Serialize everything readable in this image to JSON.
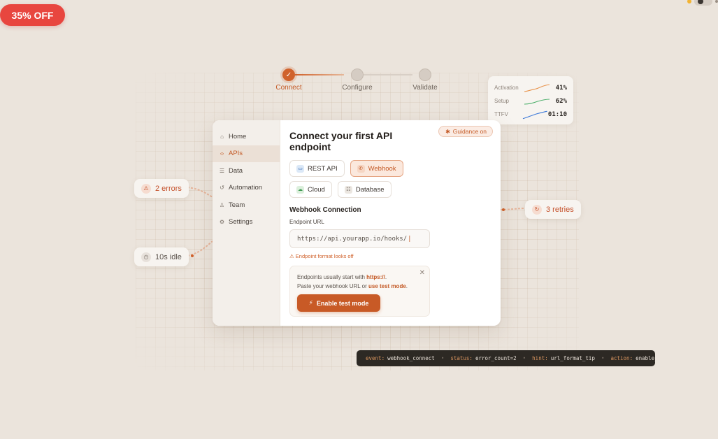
{
  "promo": {
    "label": "35% OFF"
  },
  "stepper": {
    "steps": [
      {
        "label": "Connect",
        "state": "done"
      },
      {
        "label": "Configure",
        "state": "pending"
      },
      {
        "label": "Validate",
        "state": "pending"
      }
    ]
  },
  "metrics": {
    "rows": [
      {
        "label": "Activation",
        "value": "41%",
        "color": "#e8924a"
      },
      {
        "label": "Setup",
        "value": "62%",
        "color": "#4caf6a"
      },
      {
        "label": "TTFV",
        "value": "01:10",
        "color": "#3b78d8"
      }
    ]
  },
  "chips": {
    "errors": "2 errors",
    "idle": "10s idle",
    "retries": "3 retries"
  },
  "sidebar": {
    "items": [
      {
        "label": "Home",
        "icon": "home-icon"
      },
      {
        "label": "APIs",
        "icon": "code-icon",
        "active": true
      },
      {
        "label": "Data",
        "icon": "database-icon"
      },
      {
        "label": "Automation",
        "icon": "refresh-icon"
      },
      {
        "label": "Team",
        "icon": "user-icon"
      },
      {
        "label": "Settings",
        "icon": "gear-icon"
      }
    ]
  },
  "main": {
    "title": "Connect your first API endpoint",
    "guidance": "Guidance on",
    "types": [
      {
        "label": "REST API",
        "icon": "monitor-icon",
        "selected": false
      },
      {
        "label": "Webhook",
        "icon": "phone-icon",
        "selected": true
      },
      {
        "label": "Cloud",
        "icon": "cloud-icon",
        "selected": false
      },
      {
        "label": "Database",
        "icon": "database-icon",
        "selected": false
      }
    ],
    "section_title": "Webhook Connection",
    "field_label": "Endpoint URL",
    "endpoint_value": "https://api.yourapp.io/hooks/",
    "warning": "⚠ Endpoint format looks off",
    "hint": {
      "line1_pre": "Endpoints usually start with ",
      "line1_bold": "https://",
      "line1_post": ".",
      "line2_pre": "Paste your webhook URL or ",
      "line2_bold": "use test mode",
      "line2_post": ".",
      "button": "Enable test mode"
    }
  },
  "console": {
    "entries": [
      {
        "key": "event:",
        "value": "webhook_connect"
      },
      {
        "key": "status:",
        "value": "error_count=2"
      },
      {
        "key": "hint:",
        "value": "url_format_tip"
      },
      {
        "key": "action:",
        "value": "enable_test_mode"
      }
    ]
  },
  "colors": {
    "accent": "#c85a26",
    "background": "#ebe4dc",
    "promo": "#e8463f"
  }
}
